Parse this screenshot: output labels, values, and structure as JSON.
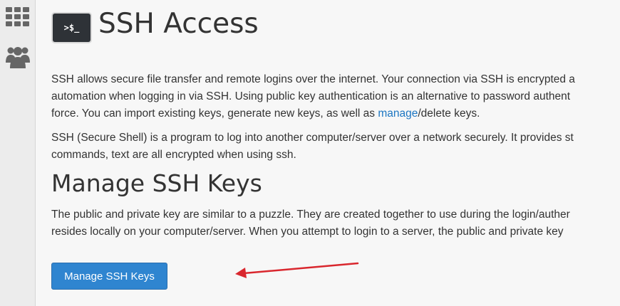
{
  "sidebar": {
    "icons": [
      "grid-icon",
      "users-icon"
    ]
  },
  "header": {
    "icon_text": ">$_",
    "title": "SSH Access"
  },
  "intro": {
    "line1": "SSH allows secure file transfer and remote logins over the internet. Your connection via SSH is encrypted a",
    "line2": "automation when logging in via SSH. Using public key authentication is an alternative to password authent",
    "line3_before": "force. You can import existing keys, generate new keys, as well as ",
    "line3_link": "manage",
    "line3_after": "/delete keys."
  },
  "about": {
    "line1": "SSH (Secure Shell) is a program to log into another computer/server over a network securely. It provides st",
    "line2": "commands, text are all encrypted when using ssh."
  },
  "manage_section": {
    "title": "Manage SSH Keys",
    "line1": "The public and private key are similar to a puzzle. They are created together to use during the login/auther",
    "line2": "resides locally on your computer/server. When you attempt to login to a server, the public and private key",
    "button_label": "Manage SSH Keys"
  },
  "colors": {
    "link": "#1c76c2",
    "button": "#2f85d0",
    "annotation_arrow": "#d9272e"
  }
}
